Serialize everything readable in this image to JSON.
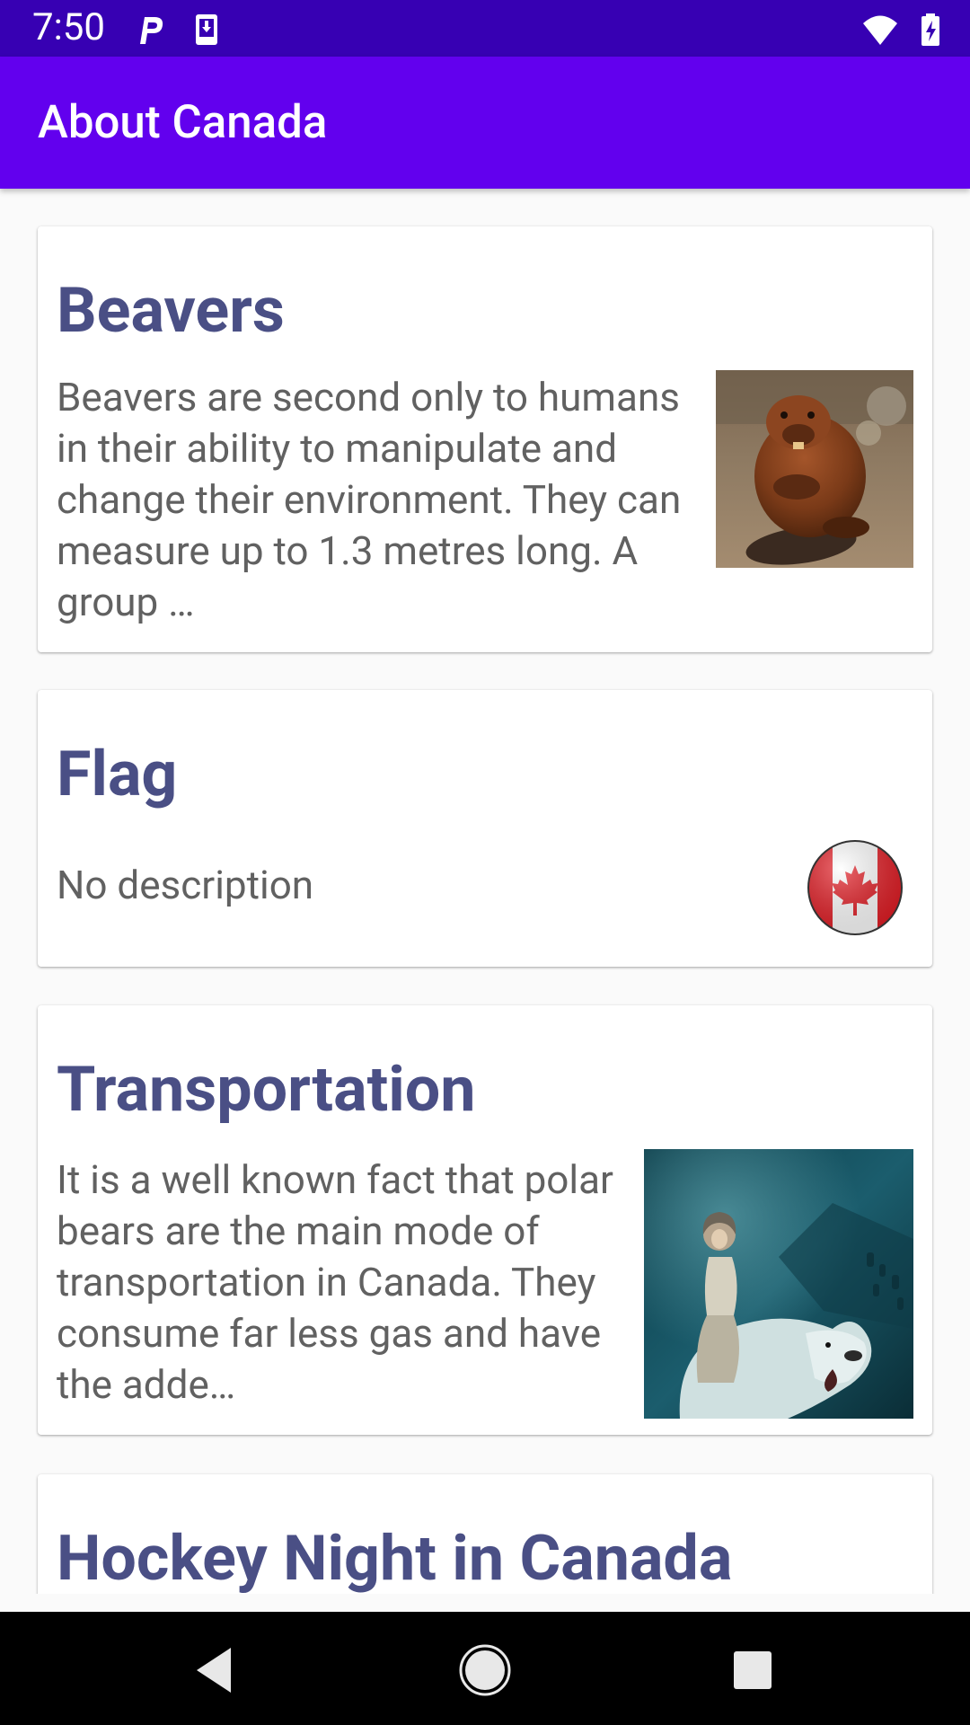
{
  "status_bar": {
    "time": "7:50",
    "icons": [
      "parking-icon",
      "download-icon",
      "wifi-icon",
      "battery-icon"
    ]
  },
  "app_bar": {
    "title": "About Canada"
  },
  "cards": [
    {
      "title": "Beavers",
      "description": "Beavers are second only to humans in their ability to manipulate and change their environment. They can measure up to 1.3 metres long. A group …",
      "image": "beaver-photo"
    },
    {
      "title": "Flag",
      "description": "No description",
      "image": "canada-flag-icon"
    },
    {
      "title": "Transportation",
      "description": "It is a well known fact that polar bears are the main mode of transportation in Canada. They consume far less gas and have the adde…",
      "image": "polar-bear-rider-photo"
    },
    {
      "title": "Hockey Night in Canada",
      "description": ""
    }
  ],
  "nav_bar": {
    "buttons": [
      "back-icon",
      "home-icon",
      "recents-icon"
    ]
  },
  "colors": {
    "status_bar": "#3700b3",
    "app_bar": "#6200ee",
    "card_title": "#4a4f85",
    "card_text": "#616161"
  }
}
